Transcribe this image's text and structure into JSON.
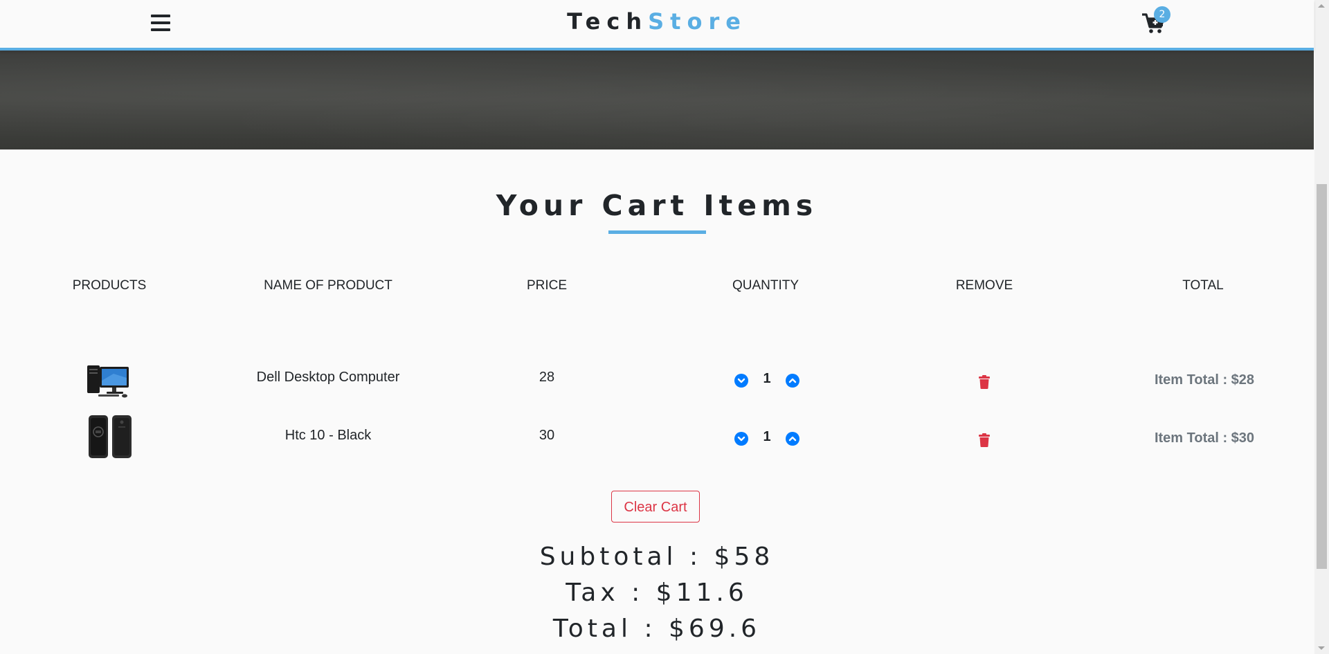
{
  "brand": {
    "part1": "Tech",
    "part2": "Store"
  },
  "cart": {
    "badge_count": "2"
  },
  "section": {
    "title": "Your Cart Items"
  },
  "table": {
    "headers": [
      "PRODUCTS",
      "NAME OF PRODUCT",
      "PRICE",
      "QUANTITY",
      "REMOVE",
      "TOTAL"
    ],
    "rows": [
      {
        "name": "Dell Desktop Computer",
        "price": "28",
        "quantity": "1",
        "item_total": "Item Total : $28",
        "image": "desktop-computer-image"
      },
      {
        "name": "Htc 10 - Black",
        "price": "30",
        "quantity": "1",
        "item_total": "Item Total : $30",
        "image": "phone-image"
      }
    ]
  },
  "actions": {
    "clear_cart": "Clear Cart"
  },
  "summary": {
    "subtotal": "Subtotal : $58",
    "tax": "Tax : $11.6",
    "total": "Total : $69.6"
  },
  "colors": {
    "accent": "#5aaee3",
    "danger": "#dc3545",
    "primary": "#007bff"
  }
}
